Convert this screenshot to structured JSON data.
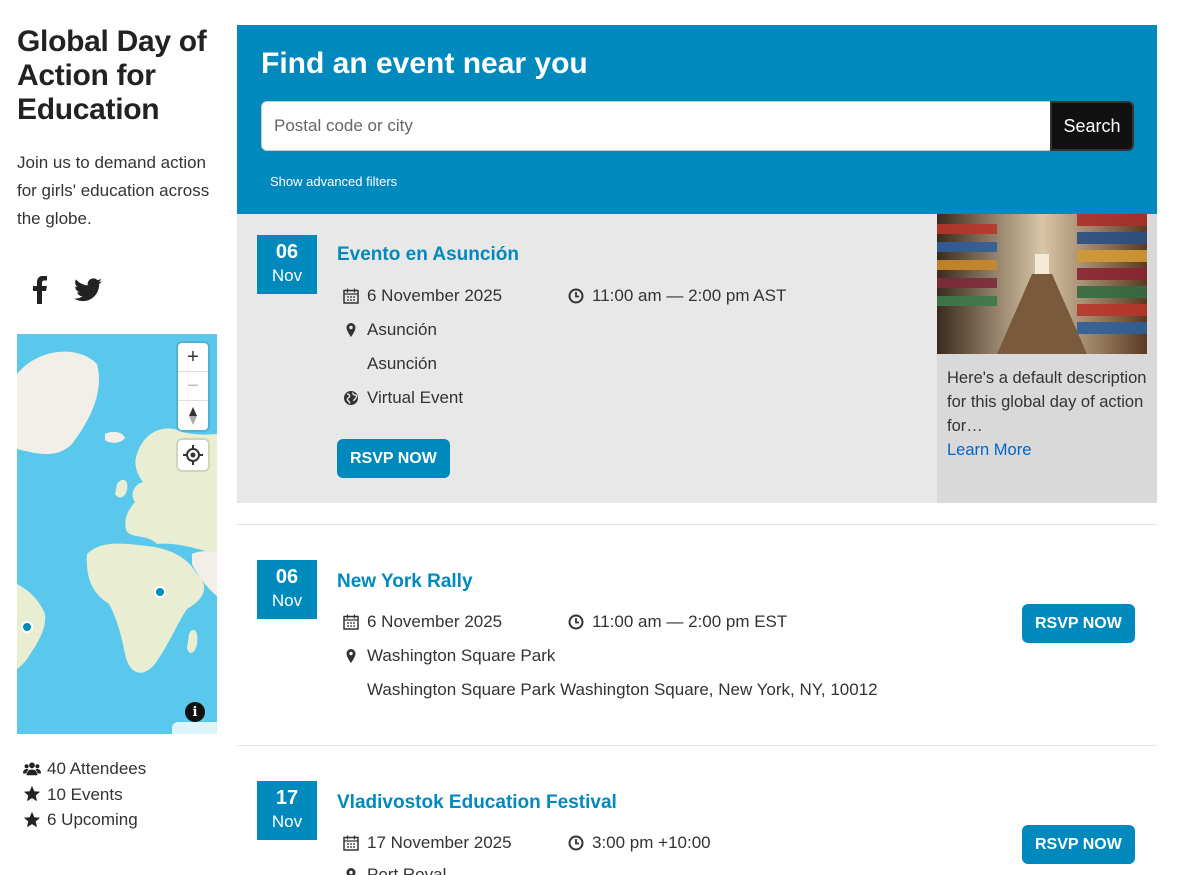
{
  "sidebar": {
    "title": "Global Day of Action for Education",
    "description": "Join us to demand action for girls' education across the globe.",
    "social": {
      "facebook_icon": "facebook-icon",
      "twitter_icon": "twitter-icon"
    },
    "map": {
      "zoom_in": "+",
      "zoom_out": "−",
      "compass": "compass-icon",
      "geolocate": "geolocate-icon",
      "info": "i"
    },
    "stats": [
      {
        "icon": "users-icon",
        "label": "40 Attendees"
      },
      {
        "icon": "star-icon",
        "label": "10 Events"
      },
      {
        "icon": "star-icon",
        "label": "6 Upcoming"
      }
    ]
  },
  "finder": {
    "title": "Find an event near you",
    "search_placeholder": "Postal code or city",
    "search_button": "Search",
    "advanced_filters": "Show advanced filters"
  },
  "events": [
    {
      "day": "06",
      "month": "Nov",
      "title": "Evento en Asunción",
      "date": "6 November 2025",
      "time": "11:00 am — 2:00 pm AST",
      "venue": "Asunción",
      "address": "Asunción",
      "type": "Virtual Event",
      "rsvp": "RSVP NOW",
      "description": "Here's a default description for this global day of action for…",
      "learn_more": "Learn More"
    },
    {
      "day": "06",
      "month": "Nov",
      "title": "New York Rally",
      "date": "6 November 2025",
      "time": "11:00 am — 2:00 pm EST",
      "venue": "Washington Square Park",
      "address": "Washington Square Park Washington Square, New York, NY, 10012",
      "rsvp": "RSVP NOW"
    },
    {
      "day": "17",
      "month": "Nov",
      "title": "Vladivostok Education Festival",
      "date": "17 November 2025",
      "time": "3:00 pm +10:00",
      "venue": "Port Royal",
      "rsvp": "RSVP NOW"
    }
  ],
  "colors": {
    "brand_blue": "#0089bd",
    "featured_bg": "#e8e8e8",
    "side_bg": "#d9d9d9",
    "map_water": "#5ac8ec"
  }
}
